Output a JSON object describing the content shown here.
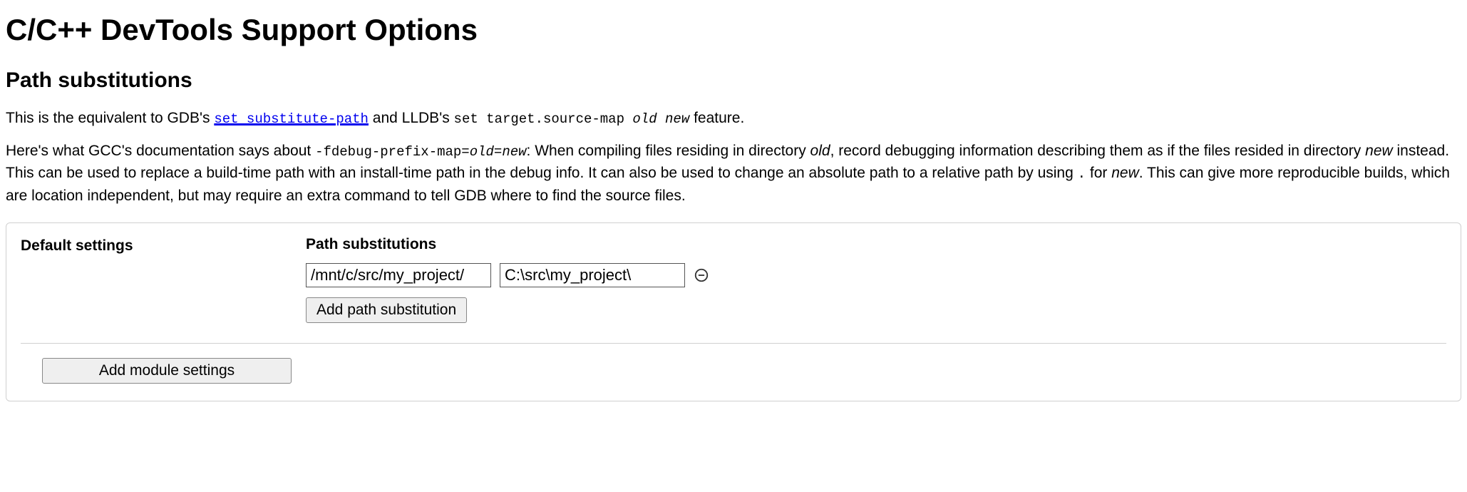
{
  "page": {
    "title": "C/C++ DevTools Support Options",
    "section_heading": "Path substitutions"
  },
  "intro": {
    "p1_prefix": "This is the equivalent to GDB's ",
    "p1_link": "set substitute-path",
    "p1_mid": " and LLDB's ",
    "p1_code2": "set target.source-map ",
    "p1_code2_it1": "old",
    "p1_code2_sp": " ",
    "p1_code2_it2": "new",
    "p1_suffix": " feature.",
    "p2_a": "Here's what GCC's documentation says about ",
    "p2_code": "-fdebug-prefix-map=",
    "p2_code_it1": "old",
    "p2_code_eq": "=",
    "p2_code_it2": "new",
    "p2_b": ": When compiling files residing in directory ",
    "p2_it_old": "old",
    "p2_c": ", record debugging information describing them as if the files resided in directory ",
    "p2_it_new": "new",
    "p2_d": " instead. This can be used to replace a build-time path with an install-time path in the debug info. It can also be used to change an absolute path to a relative path by using ",
    "p2_dot": ".",
    "p2_e": " for ",
    "p2_it_new2": "new",
    "p2_f": ". This can give more reproducible builds, which are location independent, but may require an extra command to tell GDB where to find the source files."
  },
  "panel": {
    "default_label": "Default settings",
    "subheading": "Path substitutions",
    "from_value": "/mnt/c/src/my_project/",
    "to_value": "C:\\src\\my_project\\",
    "add_sub_button": "Add path substitution",
    "add_module_button": "Add module settings"
  }
}
